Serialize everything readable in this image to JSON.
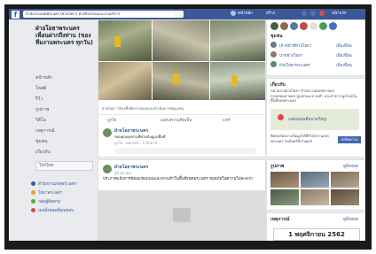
{
  "topbar": {
    "logo": "f",
    "search_text": "สำนักงานเขตพระนคร (ฝ่ายโยธา) ฝ่ายกิจกรรมและงานบริการ",
    "nav": [
      "หน้าหลัก",
      "สร้าง",
      "หน้าแรก"
    ]
  },
  "page": {
    "name": "ฝ่ายโยธาพระนคร เพื่อนฝากถึงท่าน (ของ ทีมงานพระนคร ทุกวัน)",
    "nav": [
      "หน้าหลัก",
      "โพสต์",
      "รีวิว",
      "รูปภาพ",
      "วิดีโอ",
      "เหตุการณ์",
      "ชุมชน",
      "เกี่ยวกับ"
    ],
    "promote_label": "โปรโมท",
    "left_links": [
      "สำนักงานเขตพระนคร",
      "โยธาพระนคร",
      "กลุ่มผู้ติดตาม",
      "เพจทั้งหมดที่คุณชอบ"
    ]
  },
  "post1": {
    "caption": "ฝ่ายโยธา ได้ลงพื้นที่ตรวจสอบและดำเนินการซ่อมแซม",
    "actions": [
      "ถูกใจ",
      "แสดงความคิดเห็น",
      "แชร์"
    ],
    "comment_author": "ฝ่ายโยธาพระนคร",
    "comment_text": "ขอบคุณทุกท่านที่ช่วยกันดูแลพื้นที่",
    "comment_meta": "ถูกใจ · ตอบกลับ · 2 สัปดาห์"
  },
  "post2": {
    "author": "ฝ่ายโยธาพระนคร",
    "time": "30 ตุลาคม",
    "text": "ประกาศแจ้งการซ่อมแซมถนนและทางเท้าในพื้นที่เขตพระนคร ขออภัยในความไม่สะดวก"
  },
  "right": {
    "section1_title": "ชุมชน",
    "people": [
      {
        "name": "เจ้าหน้าที่ฝ่ายโยธา",
        "action": "เพิ่มเพื่อน"
      },
      {
        "name": "นายช่างโยธา",
        "action": "เพิ่มเพื่อน"
      },
      {
        "name": "ฝ่ายโยธาพระนคร",
        "action": "เพิ่มเพื่อน"
      }
    ],
    "section2_title": "เกี่ยวกับ",
    "about_text": "หน่วยงานฝ่ายโยธา สำนักงานเขตพระนคร กรุงเทพมหานคร ดูแลถนน ทางเท้า และสาธารณูปโภคในพื้นที่เขตพระนคร",
    "map_link": "แสดงแผนที่ขนาดใหญ่",
    "contact_text": "ติดต่อสอบถามข้อมูลได้ที่สำนักงานเขตพระนคร วันจันทร์ถึงวันศุกร์",
    "contact_btn": "ส่งข้อความ",
    "photos_title": "รูปภาพ",
    "photos_link": "ดูทั้งหมด",
    "events_title": "เหตุการณ์",
    "events_link": "ดูทั้งหมด",
    "date_label": "1 พฤศจิกายน 2562"
  },
  "colors": {
    "brand": "#3b5998",
    "link": "#385898"
  }
}
